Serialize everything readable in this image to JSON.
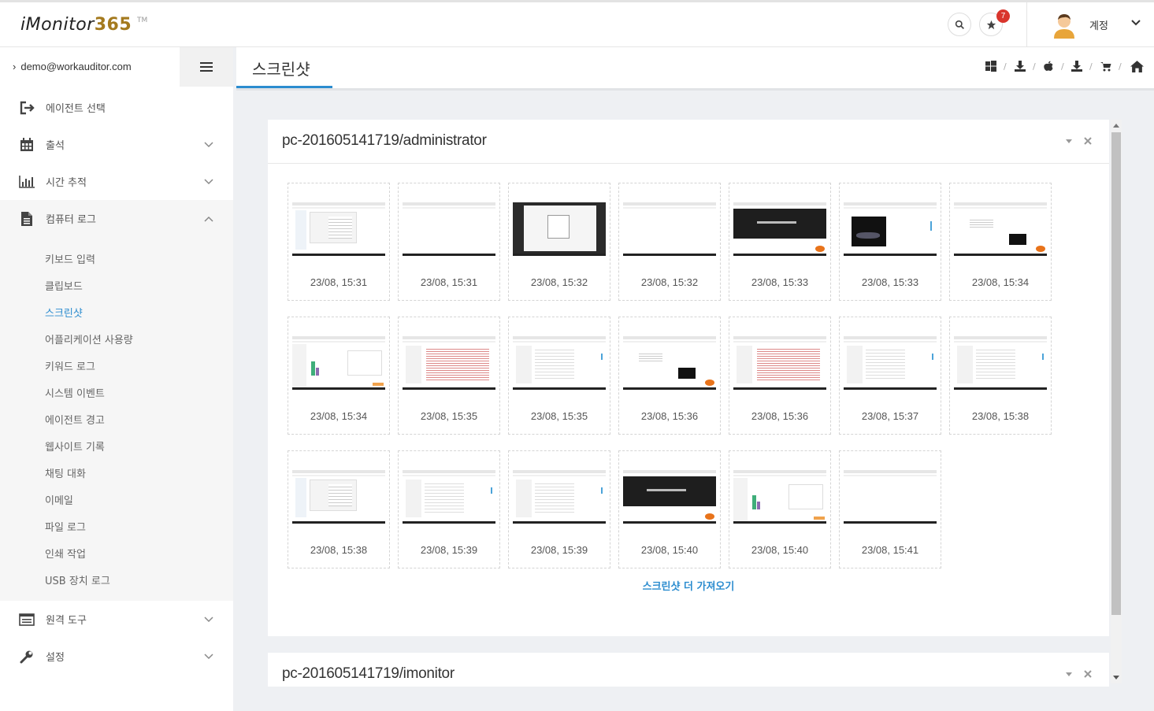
{
  "header": {
    "logo_text": "iMonitor",
    "logo_num": "365",
    "logo_tm": "TM",
    "notification_count": "7",
    "account_label": "계정"
  },
  "sidebar": {
    "user_email": "demo@workauditor.com",
    "items": [
      {
        "label": "에이전트 선택",
        "icon": "sign-out-icon"
      },
      {
        "label": "출석",
        "icon": "calendar-icon"
      },
      {
        "label": "시간 추적",
        "icon": "bar-chart-icon"
      },
      {
        "label": "컴퓨터 로그",
        "icon": "file-icon"
      },
      {
        "label": "원격 도구",
        "icon": "list-icon"
      },
      {
        "label": "설정",
        "icon": "wrench-icon"
      }
    ],
    "sub_items": [
      "키보드 입력",
      "클립보드",
      "스크린샷",
      "어플리케이션 사용량",
      "키워드 로그",
      "시스템 이벤트",
      "에이전트 경고",
      "웹사이트 기록",
      "채팅 대화",
      "이메일",
      "파일 로그",
      "인쇄 작업",
      "USB 장치 로그"
    ],
    "active_sub": "스크린샷"
  },
  "page": {
    "title": "스크린샷",
    "breadcrumb_icons": [
      "windows-icon",
      "download-icon",
      "apple-icon",
      "download-icon",
      "cart-icon",
      "home-icon"
    ]
  },
  "panels": [
    {
      "title": "pc-201605141719/administrator",
      "screenshots": [
        {
          "time": "23/08, 15:31",
          "style": "explorer"
        },
        {
          "time": "23/08, 15:31",
          "style": "blank"
        },
        {
          "time": "23/08, 15:32",
          "style": "dark-dialog"
        },
        {
          "time": "23/08, 15:32",
          "style": "blank"
        },
        {
          "time": "23/08, 15:33",
          "style": "dark-banner"
        },
        {
          "time": "23/08, 15:33",
          "style": "car"
        },
        {
          "time": "23/08, 15:34",
          "style": "web"
        },
        {
          "time": "23/08, 15:34",
          "style": "chart"
        },
        {
          "time": "23/08, 15:35",
          "style": "table"
        },
        {
          "time": "23/08, 15:35",
          "style": "list"
        },
        {
          "time": "23/08, 15:36",
          "style": "web"
        },
        {
          "time": "23/08, 15:36",
          "style": "table"
        },
        {
          "time": "23/08, 15:37",
          "style": "list"
        },
        {
          "time": "23/08, 15:38",
          "style": "list"
        },
        {
          "time": "23/08, 15:38",
          "style": "explorer"
        },
        {
          "time": "23/08, 15:39",
          "style": "list"
        },
        {
          "time": "23/08, 15:39",
          "style": "list"
        },
        {
          "time": "23/08, 15:40",
          "style": "dark-banner"
        },
        {
          "time": "23/08, 15:40",
          "style": "chart"
        },
        {
          "time": "23/08, 15:41",
          "style": "blank"
        }
      ],
      "more_label": "스크린샷 더 가져오기"
    },
    {
      "title": "pc-201605141719/imonitor"
    }
  ],
  "colors": {
    "accent": "#2b8ccf",
    "badge": "#d9352c",
    "logo_num": "#a47a1e"
  }
}
